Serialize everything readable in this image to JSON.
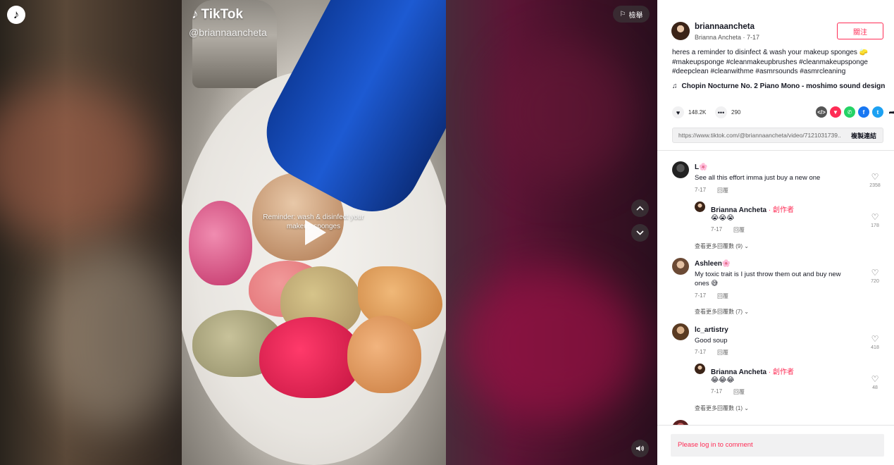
{
  "video": {
    "brand": "TikTok",
    "watermark_handle": "@briannaancheta",
    "caption": "Reminder: wash & disinfect your makeup sponges",
    "report_label": "檢舉",
    "icons": [
      "tiktok-logo-icon",
      "play-icon",
      "flag-icon",
      "chevron-up-icon",
      "chevron-down-icon",
      "volume-icon"
    ]
  },
  "author": {
    "username": "briannaancheta",
    "display": "Brianna Ancheta · 7-17",
    "follow_label": "關注"
  },
  "post": {
    "description": "heres a reminder to disinfect & wash your makeup sponges 🧽",
    "hashtags": "#makeupsponge #cleanmakeupbrushes #cleanmakeupsponge #deepclean #cleanwithme #asmrsounds #asmrcleaning",
    "music": "Chopin Nocturne No. 2 Piano Mono - moshimo sound design"
  },
  "stats": {
    "likes": "148.2K",
    "comments": "290"
  },
  "share_icons": [
    "embed-icon",
    "send-icon",
    "whatsapp-icon",
    "facebook-icon",
    "twitter-icon",
    "share-arrow-icon"
  ],
  "link": {
    "url": "https://www.tiktok.com/@briannaancheta/video/7121031739...",
    "copy_label": "複製連結"
  },
  "comments": [
    {
      "user": "L🌸",
      "text": "See all this effort imma just buy a new one",
      "date": "7-17",
      "reply_label": "回覆",
      "likes": "2358",
      "replies": [
        {
          "user": "Brianna Ancheta",
          "creator_tag": " · 創作者",
          "text": "😭😭😭",
          "date": "7-17",
          "reply_label": "回覆",
          "likes": "178"
        }
      ],
      "more": "查看更多回覆數 (9)"
    },
    {
      "user": "Ashleen🌸",
      "text": "My toxic trait is I just throw them out and buy new ones 😅",
      "date": "7-17",
      "reply_label": "回覆",
      "likes": "720",
      "more": "查看更多回覆數 (7)"
    },
    {
      "user": "lc_artistry",
      "text": "Good soup",
      "date": "7-17",
      "reply_label": "回覆",
      "likes": "418",
      "replies": [
        {
          "user": "Brianna Ancheta",
          "creator_tag": " · 創作者",
          "text": "😂😂😂",
          "date": "7-17",
          "reply_label": "回覆",
          "likes": "48"
        }
      ],
      "more": "查看更多回覆數 (1)"
    }
  ],
  "login_prompt": "Please log in to comment",
  "colors": {
    "accent": "#fe2c55",
    "text": "#161823"
  }
}
